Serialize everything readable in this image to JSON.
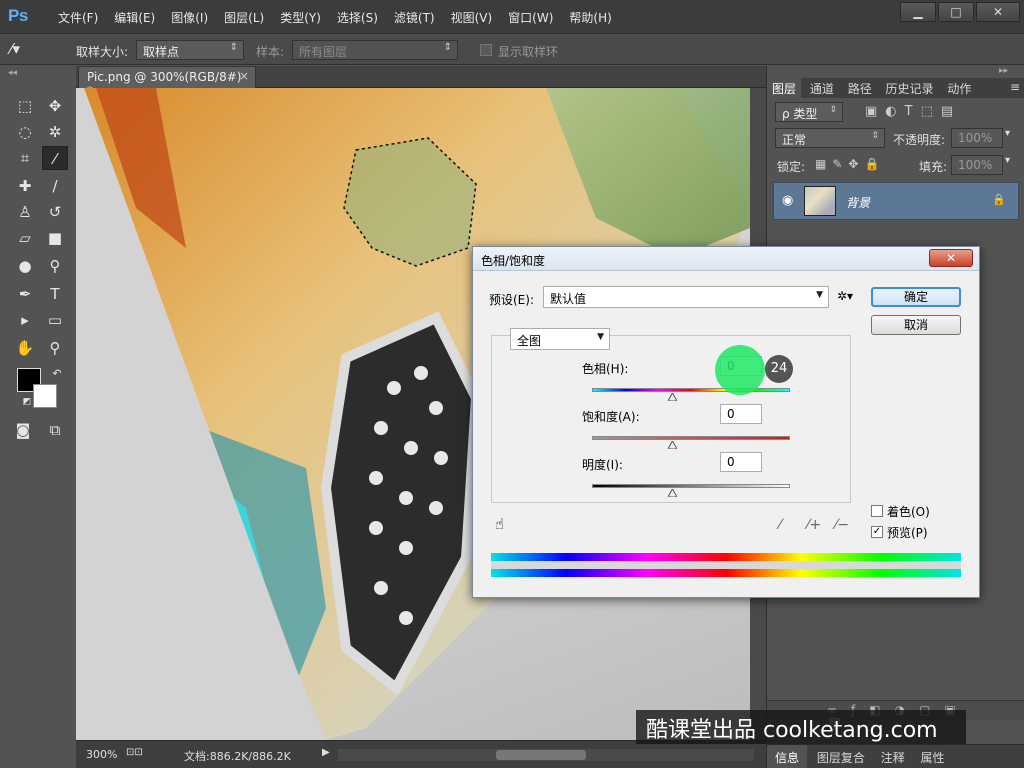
{
  "app": {
    "logo": "Ps"
  },
  "menu": [
    "文件(F)",
    "编辑(E)",
    "图像(I)",
    "图层(L)",
    "类型(Y)",
    "选择(S)",
    "滤镜(T)",
    "视图(V)",
    "窗口(W)",
    "帮助(H)"
  ],
  "window_controls": {
    "minimize": "▁",
    "maximize": "□",
    "close": "✕"
  },
  "options": {
    "sample_size_label": "取样大小:",
    "sample_size_value": "取样点",
    "sample_label": "样本:",
    "sample_value": "所有图层",
    "show_ring_label": "显示取样环"
  },
  "document": {
    "tab_title": "Pic.png @ 300%(RGB/8#) *",
    "close_glyph": "×",
    "zoom": "300%",
    "doc_size": "文档:886.2K/886.2K"
  },
  "layers_panel": {
    "tabs": [
      "图层",
      "通道",
      "路径",
      "历史记录",
      "动作"
    ],
    "filter_kind": "ρ 类型",
    "blend_mode": "正常",
    "opacity_label": "不透明度:",
    "opacity_value": "100%",
    "lock_label": "锁定:",
    "fill_label": "填充:",
    "fill_value": "100%",
    "layer_name": "背景"
  },
  "bottom_tabs": [
    "信息",
    "图层复合",
    "注释",
    "属性"
  ],
  "watermark": "酷课堂出品 coolketang.com",
  "dialog": {
    "title": "色相/饱和度",
    "close_glyph": "✕",
    "preset_label": "预设(E):",
    "preset_value": "默认值",
    "ok_label": "确定",
    "cancel_label": "取消",
    "channel_value": "全图",
    "hue_label": "色相(H):",
    "hue_value": "0",
    "saturation_label": "饱和度(A):",
    "saturation_value": "0",
    "lightness_label": "明度(I):",
    "lightness_value": "0",
    "colorize_label": "着色(O)",
    "preview_label": "预览(P)",
    "preview_checked": true,
    "colorize_checked": false,
    "click_badge": "24"
  }
}
